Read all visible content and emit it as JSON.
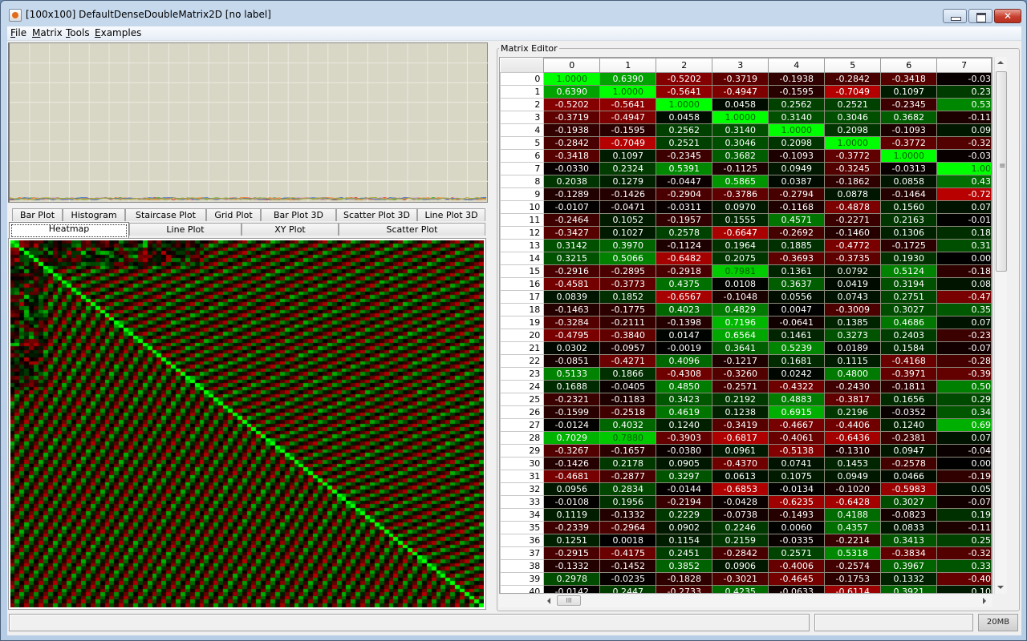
{
  "window": {
    "title": "[100x100] DefaultDenseDoubleMatrix2D [no label]",
    "app_icon": "java-icon",
    "controls": {
      "minimize": "minimize-icon",
      "maximize": "maximize-icon",
      "close": "close-icon"
    }
  },
  "menubar": {
    "items": [
      {
        "label": "File",
        "mnemonic": "F"
      },
      {
        "label": "Matrix",
        "mnemonic": "M"
      },
      {
        "label": "Tools",
        "mnemonic": "T"
      },
      {
        "label": "Examples",
        "mnemonic": "E"
      }
    ]
  },
  "plot_tabs": {
    "row1": [
      "Bar Plot",
      "Histogram",
      "Staircase Plot",
      "Grid Plot",
      "Bar Plot 3D",
      "Scatter Plot 3D",
      "Line Plot 3D"
    ],
    "row2": [
      "Heatmap",
      "Line Plot",
      "XY Plot",
      "Scatter Plot"
    ],
    "selected": "Heatmap"
  },
  "heatmap": {
    "matrix_size": "100x100",
    "color_positive": "#00ff00",
    "color_negative": "#ff0000",
    "color_zero": "#000000"
  },
  "matrix_editor": {
    "title": "Matrix Editor",
    "column_headers": [
      "0",
      "1",
      "2",
      "3",
      "4",
      "5",
      "6",
      "7"
    ],
    "rows": [
      {
        "index": "0",
        "values": [
          "1.0000",
          "0.6390",
          "-0.5202",
          "-0.3719",
          "-0.1938",
          "-0.2842",
          "-0.3418",
          "-0.03"
        ]
      },
      {
        "index": "1",
        "values": [
          "0.6390",
          "1.0000",
          "-0.5641",
          "-0.4947",
          "-0.1595",
          "-0.7049",
          "0.1097",
          "0.23"
        ]
      },
      {
        "index": "2",
        "values": [
          "-0.5202",
          "-0.5641",
          "1.0000",
          "0.0458",
          "0.2562",
          "0.2521",
          "-0.2345",
          "0.53"
        ]
      },
      {
        "index": "3",
        "values": [
          "-0.3719",
          "-0.4947",
          "0.0458",
          "1.0000",
          "0.3140",
          "0.3046",
          "0.3682",
          "-0.11"
        ]
      },
      {
        "index": "4",
        "values": [
          "-0.1938",
          "-0.1595",
          "0.2562",
          "0.3140",
          "1.0000",
          "0.2098",
          "-0.1093",
          "0.09"
        ]
      },
      {
        "index": "5",
        "values": [
          "-0.2842",
          "-0.7049",
          "0.2521",
          "0.3046",
          "0.2098",
          "1.0000",
          "-0.3772",
          "-0.32"
        ]
      },
      {
        "index": "6",
        "values": [
          "-0.3418",
          "0.1097",
          "-0.2345",
          "0.3682",
          "-0.1093",
          "-0.3772",
          "1.0000",
          "-0.03"
        ]
      },
      {
        "index": "7",
        "values": [
          "-0.0330",
          "0.2324",
          "0.5391",
          "-0.1125",
          "0.0949",
          "-0.3245",
          "-0.0313",
          "1.00"
        ]
      },
      {
        "index": "8",
        "values": [
          "0.2038",
          "0.1279",
          "-0.0447",
          "0.5865",
          "0.0387",
          "-0.1862",
          "0.0858",
          "0.43"
        ]
      },
      {
        "index": "9",
        "values": [
          "-0.1289",
          "-0.1426",
          "-0.2904",
          "-0.3786",
          "-0.2794",
          "0.0878",
          "-0.1464",
          "-0.72"
        ]
      },
      {
        "index": "10",
        "values": [
          "-0.0107",
          "-0.0471",
          "-0.0311",
          "0.0970",
          "-0.1168",
          "-0.4878",
          "0.1560",
          "0.07"
        ]
      },
      {
        "index": "11",
        "values": [
          "-0.2464",
          "0.1052",
          "-0.1957",
          "0.1555",
          "0.4571",
          "-0.2271",
          "0.2163",
          "-0.01"
        ]
      },
      {
        "index": "12",
        "values": [
          "-0.3427",
          "0.1027",
          "0.2578",
          "-0.6647",
          "-0.2692",
          "-0.1460",
          "0.1306",
          "0.18"
        ]
      },
      {
        "index": "13",
        "values": [
          "0.3142",
          "0.3970",
          "-0.1124",
          "0.1964",
          "0.1885",
          "-0.4772",
          "-0.1725",
          "0.31"
        ]
      },
      {
        "index": "14",
        "values": [
          "0.3215",
          "0.5066",
          "-0.6482",
          "0.2075",
          "-0.3693",
          "-0.3735",
          "0.1930",
          "0.00"
        ]
      },
      {
        "index": "15",
        "values": [
          "-0.2916",
          "-0.2895",
          "-0.2918",
          "0.7981",
          "0.1361",
          "0.0792",
          "0.5124",
          "-0.18"
        ]
      },
      {
        "index": "16",
        "values": [
          "-0.4581",
          "-0.3773",
          "0.4375",
          "0.0108",
          "0.3637",
          "0.0419",
          "0.3194",
          "0.08"
        ]
      },
      {
        "index": "17",
        "values": [
          "0.0839",
          "0.1852",
          "-0.6567",
          "-0.1048",
          "0.0556",
          "0.0743",
          "0.2751",
          "-0.47"
        ]
      },
      {
        "index": "18",
        "values": [
          "-0.1463",
          "-0.1775",
          "0.4023",
          "0.4829",
          "0.0047",
          "-0.3009",
          "0.3027",
          "0.35"
        ]
      },
      {
        "index": "19",
        "values": [
          "-0.3284",
          "-0.2111",
          "-0.1398",
          "0.7196",
          "-0.0641",
          "0.1385",
          "0.4686",
          "0.07"
        ]
      },
      {
        "index": "20",
        "values": [
          "-0.4795",
          "-0.3840",
          "0.0147",
          "0.6564",
          "0.1461",
          "0.3273",
          "0.2403",
          "-0.23"
        ]
      },
      {
        "index": "21",
        "values": [
          "0.0302",
          "-0.0957",
          "-0.0019",
          "0.3641",
          "0.5239",
          "0.0189",
          "0.1584",
          "-0.07"
        ]
      },
      {
        "index": "22",
        "values": [
          "-0.0851",
          "-0.4271",
          "0.4096",
          "-0.1217",
          "0.1681",
          "0.1115",
          "-0.4168",
          "-0.28"
        ]
      },
      {
        "index": "23",
        "values": [
          "0.5133",
          "0.1866",
          "-0.4308",
          "-0.3260",
          "0.0242",
          "0.4800",
          "-0.3971",
          "-0.39"
        ]
      },
      {
        "index": "24",
        "values": [
          "0.1688",
          "-0.0405",
          "0.4850",
          "-0.2571",
          "-0.4322",
          "-0.2430",
          "-0.1811",
          "0.50"
        ]
      },
      {
        "index": "25",
        "values": [
          "-0.2321",
          "-0.1183",
          "0.3423",
          "0.2192",
          "0.4883",
          "-0.3817",
          "0.1656",
          "0.29"
        ]
      },
      {
        "index": "26",
        "values": [
          "-0.1599",
          "-0.2518",
          "0.4619",
          "0.1238",
          "0.6915",
          "0.2196",
          "-0.0352",
          "0.34"
        ]
      },
      {
        "index": "27",
        "values": [
          "-0.0124",
          "0.4032",
          "0.1240",
          "-0.3419",
          "-0.4667",
          "-0.4406",
          "0.1240",
          "0.69"
        ]
      },
      {
        "index": "28",
        "values": [
          "0.7029",
          "0.7880",
          "-0.3903",
          "-0.6817",
          "-0.4061",
          "-0.6436",
          "-0.2381",
          "0.07"
        ]
      },
      {
        "index": "29",
        "values": [
          "-0.3267",
          "-0.1657",
          "-0.0380",
          "0.0961",
          "-0.5138",
          "-0.1310",
          "0.0947",
          "-0.04"
        ]
      },
      {
        "index": "30",
        "values": [
          "-0.1426",
          "0.2178",
          "0.0905",
          "-0.4370",
          "0.0741",
          "0.1453",
          "-0.2578",
          "0.00"
        ]
      },
      {
        "index": "31",
        "values": [
          "-0.4681",
          "-0.2877",
          "0.3297",
          "0.0613",
          "0.1075",
          "0.0949",
          "0.0466",
          "-0.19"
        ]
      },
      {
        "index": "32",
        "values": [
          "0.0956",
          "0.2834",
          "-0.0144",
          "-0.6853",
          "-0.0134",
          "-0.1020",
          "-0.5983",
          "0.05"
        ]
      },
      {
        "index": "33",
        "values": [
          "-0.0108",
          "0.1956",
          "-0.2194",
          "-0.0428",
          "-0.6235",
          "-0.6428",
          "0.3027",
          "-0.07"
        ]
      },
      {
        "index": "34",
        "values": [
          "0.1119",
          "-0.1332",
          "0.2229",
          "-0.0738",
          "-0.1493",
          "0.4188",
          "-0.0823",
          "0.19"
        ]
      },
      {
        "index": "35",
        "values": [
          "-0.2339",
          "-0.2964",
          "0.0902",
          "0.2246",
          "0.0060",
          "0.4357",
          "0.0833",
          "-0.11"
        ]
      },
      {
        "index": "36",
        "values": [
          "0.1251",
          "0.0018",
          "0.1154",
          "0.2159",
          "-0.0335",
          "-0.2214",
          "0.3413",
          "0.25"
        ]
      },
      {
        "index": "37",
        "values": [
          "-0.2915",
          "-0.4175",
          "0.2451",
          "-0.2842",
          "0.2571",
          "0.5318",
          "-0.3834",
          "-0.32"
        ]
      },
      {
        "index": "38",
        "values": [
          "-0.1332",
          "-0.1452",
          "0.3852",
          "0.0906",
          "-0.4006",
          "-0.2574",
          "0.3967",
          "0.33"
        ]
      },
      {
        "index": "39",
        "values": [
          "0.2978",
          "-0.0235",
          "-0.1828",
          "-0.3021",
          "-0.4645",
          "-0.1753",
          "0.1332",
          "-0.40"
        ]
      },
      {
        "index": "40",
        "values": [
          "-0.0142",
          "0.2447",
          "-0.2733",
          "0.4235",
          "-0.0633",
          "-0.6114",
          "0.3921",
          "0.10"
        ]
      }
    ]
  },
  "statusbar": {
    "message": "",
    "secondary": "",
    "memory": "20MB"
  }
}
